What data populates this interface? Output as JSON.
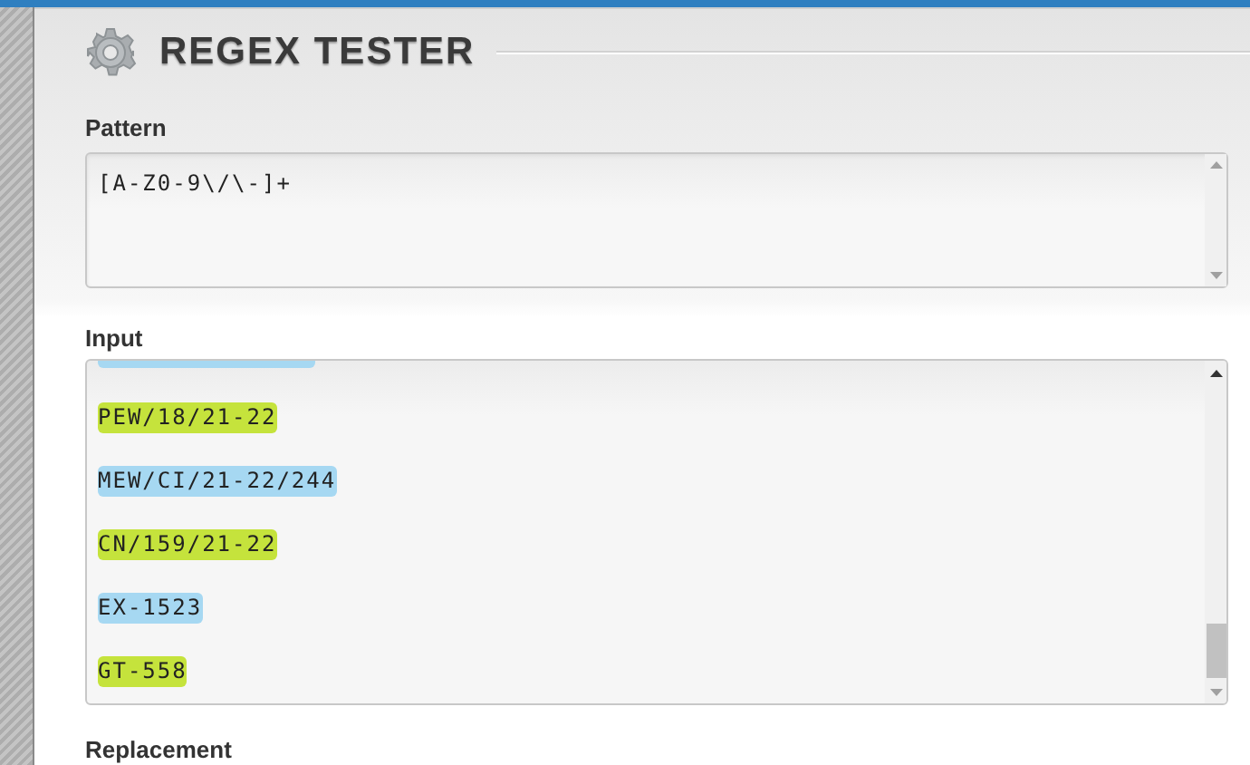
{
  "title": "REGEX TESTER",
  "pattern": {
    "label": "Pattern",
    "value": "[A-Z0-9\\/\\-]+"
  },
  "input": {
    "label": "Input",
    "matches": [
      {
        "text": "PEW/18/21-22",
        "color": "#c5e33c"
      },
      {
        "text": "MEW/CI/21-22/244",
        "color": "#a6d8f2"
      },
      {
        "text": "CN/159/21-22",
        "color": "#c5e33c"
      },
      {
        "text": "EX-1523",
        "color": "#a6d8f2"
      },
      {
        "text": "GT-558",
        "color": "#c5e33c"
      }
    ]
  },
  "replacement": {
    "label": "Replacement"
  }
}
